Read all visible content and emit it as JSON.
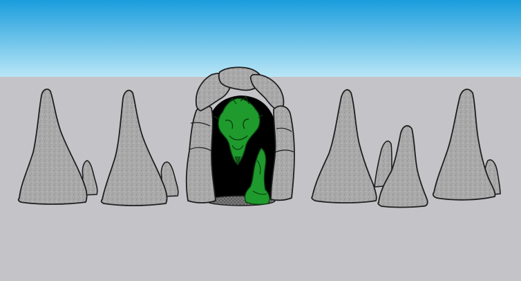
{
  "scene": {
    "sky_top_color": "#1a9ddd",
    "sky_bottom_color": "#b9e6f6",
    "ground_color": "#c3c3c8",
    "rock_color": "#a7a7a7",
    "rock_shadow_color": "#8d8d8d",
    "outline_color": "#1e1e1e",
    "cave_interior_color": "#000000",
    "creature_color": "#1e9b2c",
    "creature_dark_color": "#0d5e17",
    "floor_grate_color": "#6b6b6b"
  },
  "objects": [
    {
      "name": "stalagmite-1",
      "kind": "stalagmite with small spike"
    },
    {
      "name": "stalagmite-2",
      "kind": "stalagmite with small spike"
    },
    {
      "name": "cave-archway",
      "kind": "stone arch with green creature"
    },
    {
      "name": "stalagmite-3",
      "kind": "twin stalagmites"
    },
    {
      "name": "stalagmite-4",
      "kind": "stalagmite with side spike"
    }
  ]
}
